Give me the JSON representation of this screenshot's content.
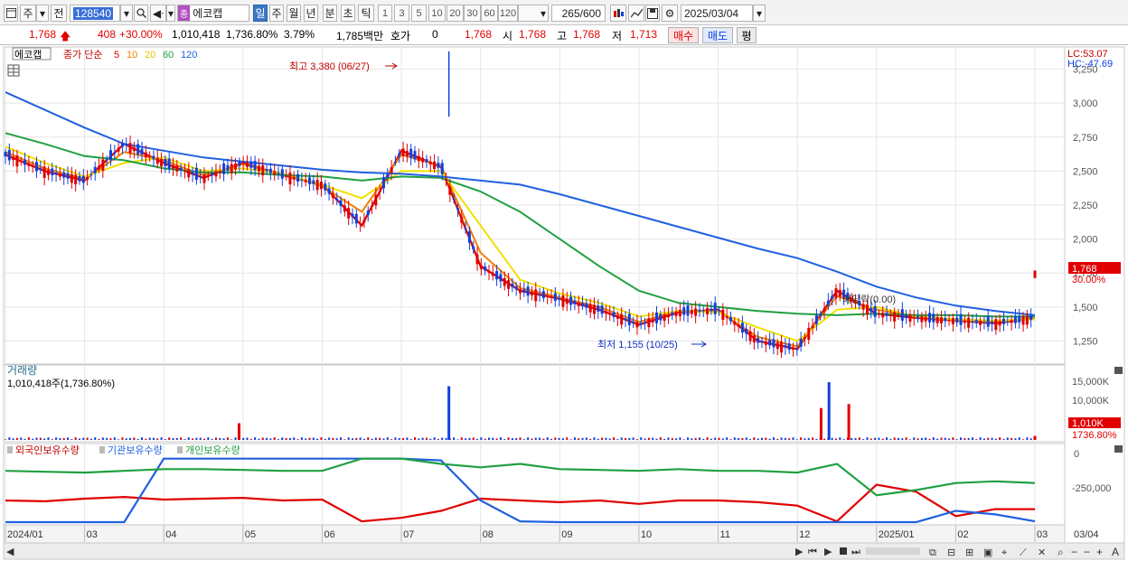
{
  "toolbar": {
    "period": "주",
    "prev": "전",
    "code": "128540",
    "stock_name": "에코캡",
    "stock_badge": "종",
    "timeframes": [
      "일",
      "주",
      "월",
      "년",
      "분",
      "초",
      "틱"
    ],
    "active_timeframe": "일",
    "intervals": [
      "1",
      "3",
      "5",
      "10",
      "20",
      "30",
      "60",
      "120"
    ],
    "count": "265",
    "count_total": "/600",
    "date": "2025/03/04"
  },
  "quote": {
    "price": "1,768",
    "change": "408",
    "change_pct": "+30.00%",
    "volume": "1,010,418",
    "volume_pct": "1,736.80%",
    "turnover_pct": "3.79%",
    "amount": "1,785백만",
    "hoga_label": "호가",
    "hoga_value": "0",
    "hoga_price": "1,768",
    "open_label": "시",
    "open": "1,768",
    "high_label": "고",
    "high": "1,768",
    "low_label": "저",
    "low": "1,713",
    "buy_label": "매수",
    "sell_label": "매도",
    "eval_label": "평"
  },
  "price_panel": {
    "name_tag": "에코캡",
    "legend_label": "종가 단순",
    "ma_periods": [
      "5",
      "10",
      "20",
      "60",
      "120"
    ],
    "ma_colors": [
      "#e00000",
      "#f08000",
      "#f0e000",
      "#20a040",
      "#2060e0"
    ],
    "lc": "LC:53.07",
    "hc": "HC:-47.69",
    "y_ticks": [
      "3,250",
      "3,000",
      "2,750",
      "2,500",
      "2,250",
      "2,000",
      "1,750",
      "1,500",
      "1,250"
    ],
    "high_annotation": "최고 3,380 (06/27)",
    "low_annotation": "최저 1,155 (10/25)",
    "dividend_annotation": "배당락(0.00)",
    "price_tag": "1,768",
    "price_tag_pct": "30.00%"
  },
  "volume_panel": {
    "title": "거래량",
    "info": "1,010,418주(1,736.80%)",
    "y_ticks": [
      "15,000K",
      "10,000K"
    ],
    "tag": "1,010K",
    "tag_pct": "1736.80%"
  },
  "holding_panel": {
    "legends": [
      "외국인보유수량",
      "기관보유수량",
      "개인보유수량"
    ],
    "legend_colors": [
      "#e00000",
      "#2060e0",
      "#20a040"
    ],
    "y_ticks": [
      "0",
      "-250,000"
    ]
  },
  "x_axis": {
    "labels": [
      "2024/01",
      "03",
      "04",
      "05",
      "06",
      "07",
      "08",
      "09",
      "10",
      "11",
      "12",
      "2025/01",
      "02",
      "03"
    ],
    "end_label": "03/04"
  },
  "chart_data": [
    {
      "type": "candlestick",
      "title": "에코캡",
      "ylim": [
        1100,
        3400
      ],
      "high": {
        "value": 3380,
        "date": "06/27"
      },
      "low": {
        "value": 1155,
        "date": "10/25"
      },
      "last_close": 1768,
      "ma_series": [
        {
          "name": "5",
          "values": [
            2620,
            2500,
            2430,
            2700,
            2560,
            2450,
            2560,
            2470,
            2400,
            2100,
            2650,
            2530,
            1800,
            1620,
            1560,
            1480,
            1370,
            1460,
            1480,
            1250,
            1190,
            1620,
            1450,
            1420,
            1400,
            1380,
            1420
          ]
        },
        {
          "name": "10",
          "values": [
            2640,
            2520,
            2440,
            2640,
            2580,
            2470,
            2550,
            2480,
            2390,
            2200,
            2620,
            2540,
            1900,
            1640,
            1570,
            1500,
            1390,
            1470,
            1470,
            1280,
            1210,
            1580,
            1480,
            1430,
            1400,
            1390,
            1420
          ]
        },
        {
          "name": "20",
          "values": [
            2680,
            2560,
            2460,
            2560,
            2600,
            2500,
            2520,
            2480,
            2400,
            2300,
            2500,
            2500,
            2100,
            1700,
            1600,
            1530,
            1430,
            1470,
            1460,
            1350,
            1250,
            1480,
            1500,
            1430,
            1410,
            1400,
            1410
          ]
        },
        {
          "name": "60",
          "values": [
            2780,
            2700,
            2610,
            2580,
            2520,
            2490,
            2490,
            2470,
            2460,
            2430,
            2460,
            2450,
            2350,
            2200,
            2000,
            1800,
            1620,
            1530,
            1500,
            1470,
            1450,
            1440,
            1450,
            1440,
            1440,
            1430,
            1430
          ]
        },
        {
          "name": "120",
          "values": [
            3080,
            2950,
            2820,
            2700,
            2650,
            2600,
            2570,
            2540,
            2510,
            2490,
            2480,
            2460,
            2430,
            2400,
            2330,
            2250,
            2170,
            2090,
            2010,
            1930,
            1860,
            1760,
            1650,
            1570,
            1510,
            1470,
            1440
          ]
        }
      ]
    },
    {
      "type": "bar",
      "title": "거래량",
      "ylim": [
        0,
        17000000
      ],
      "spikes": [
        {
          "label": "2024/03 end",
          "value": 4200000
        },
        {
          "label": "06/27",
          "value": 13500000
        },
        {
          "label": "11 mid",
          "value": 14500000
        },
        {
          "label": "11 mid b",
          "value": 8000000
        },
        {
          "label": "11 mid c",
          "value": 9000000
        },
        {
          "label": "03/04",
          "value": 1010418
        }
      ]
    },
    {
      "type": "line",
      "title": "보유수량",
      "ylim": [
        -380000,
        30000
      ],
      "series": [
        {
          "name": "외국인보유수량",
          "values": [
            -250000,
            -255000,
            -240000,
            -230000,
            -245000,
            -240000,
            -235000,
            -250000,
            -245000,
            -370000,
            -350000,
            -310000,
            -240000,
            -250000,
            -260000,
            -250000,
            -270000,
            -250000,
            -250000,
            -260000,
            -280000,
            -370000,
            -160000,
            -200000,
            -340000,
            -300000,
            -300000
          ]
        },
        {
          "name": "기관보유수량",
          "values": [
            -375000,
            -375000,
            -375000,
            -375000,
            -10000,
            -10000,
            -10000,
            -10000,
            -10000,
            -10000,
            -10000,
            -20000,
            -250000,
            -370000,
            -375000,
            -375000,
            -375000,
            -375000,
            -375000,
            -375000,
            -375000,
            -375000,
            -375000,
            -375000,
            -310000,
            -330000,
            -370000
          ]
        },
        {
          "name": "개인보유수량",
          "values": [
            -80000,
            -85000,
            -90000,
            -80000,
            -70000,
            -70000,
            -75000,
            -80000,
            -80000,
            -10000,
            -10000,
            -40000,
            -60000,
            -40000,
            -70000,
            -75000,
            -80000,
            -70000,
            -80000,
            -80000,
            -90000,
            -40000,
            -220000,
            -190000,
            -150000,
            -140000,
            -150000
          ]
        }
      ]
    }
  ]
}
